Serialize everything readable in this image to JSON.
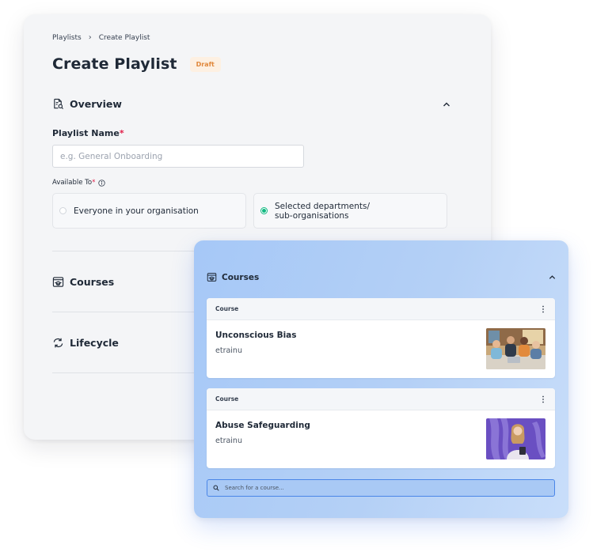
{
  "breadcrumb": {
    "parent": "Playlists",
    "separator": "›",
    "current": "Create Playlist"
  },
  "header": {
    "title": "Create Playlist",
    "badge": "Draft"
  },
  "overview": {
    "label": "Overview",
    "playlist_name_label": "Playlist Name",
    "playlist_name_placeholder": "e.g. General Onboarding",
    "required_mark": "*",
    "available_to_label": "Available To",
    "options": [
      {
        "label": "Everyone in your organisation",
        "selected": false
      },
      {
        "label": "Selected departments/\nsub-organisations",
        "selected": true
      }
    ]
  },
  "sections": {
    "courses_label": "Courses",
    "lifecycle_label": "Lifecycle"
  },
  "courses_panel": {
    "label": "Courses",
    "cards": [
      {
        "type": "Course",
        "title": "Unconscious Bias",
        "provider": "etrainu",
        "thumb": "meeting-photo"
      },
      {
        "type": "Course",
        "title": "Abuse Safeguarding",
        "provider": "etrainu",
        "thumb": "woman-purple-photo"
      }
    ],
    "search_placeholder": "Search for a course..."
  },
  "colors": {
    "accent_green": "#10b981",
    "draft_badge_text": "#e0873a",
    "draft_badge_bg": "#fdf0e2",
    "panel_blue": "#a6c8f7",
    "required_red": "#e11d48"
  }
}
